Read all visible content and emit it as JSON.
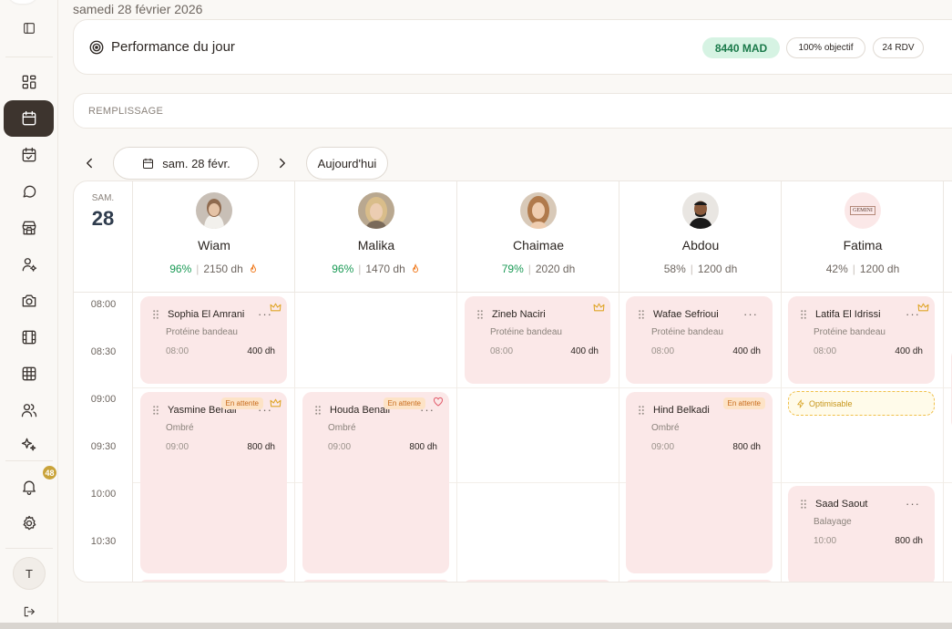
{
  "app": {
    "date_full": "samedi 28 février 2026"
  },
  "sidebar": {
    "notifications_count": "48",
    "user_initial": "T",
    "items": [
      {
        "name": "toggle-sidebar"
      },
      {
        "name": "dashboard"
      },
      {
        "name": "calendar",
        "active": true
      },
      {
        "name": "appointments"
      },
      {
        "name": "messages"
      },
      {
        "name": "store"
      },
      {
        "name": "staff-settings"
      },
      {
        "name": "camera"
      },
      {
        "name": "media"
      },
      {
        "name": "grid"
      },
      {
        "name": "clients"
      },
      {
        "name": "ai-sparkles"
      }
    ]
  },
  "performance": {
    "title": "Performance du jour",
    "revenue": "8440 MAD",
    "objective": "100% objectif",
    "appointments": "24 RDV"
  },
  "remplissage": {
    "label": "REMPLISSAGE"
  },
  "nav": {
    "date_label": "sam. 28 févr.",
    "today_label": "Aujourd'hui"
  },
  "calendar": {
    "day_of_week": "SAM.",
    "day_number": "28",
    "times": [
      "08:00",
      "08:30",
      "09:00",
      "09:30",
      "10:00",
      "10:30"
    ],
    "staff": [
      {
        "name": "Wiam",
        "pct": "96%",
        "revenue": "2150 dh",
        "hot": true,
        "green": true
      },
      {
        "name": "Malika",
        "pct": "96%",
        "revenue": "1470 dh",
        "hot": true,
        "green": true
      },
      {
        "name": "Chaimae",
        "pct": "79%",
        "revenue": "2020 dh",
        "hot": false,
        "green": true
      },
      {
        "name": "Abdou",
        "pct": "58%",
        "revenue": "1200 dh",
        "hot": false,
        "green": false
      },
      {
        "name": "Fatima",
        "pct": "42%",
        "revenue": "1200 dh",
        "hot": false,
        "green": false,
        "logo": "GEMINI"
      }
    ],
    "appointments": {
      "a1": {
        "client": "Sophia El Amrani",
        "service": "Protéine bandeau",
        "time": "08:00",
        "price": "400 dh"
      },
      "a2": {
        "client": "Zineb Naciri",
        "service": "Protéine bandeau",
        "time": "08:00",
        "price": "400 dh"
      },
      "a3": {
        "client": "Wafae Sefrioui",
        "service": "Protéine bandeau",
        "time": "08:00",
        "price": "400 dh"
      },
      "a4": {
        "client": "Latifa El Idrissi",
        "service": "Protéine bandeau",
        "time": "08:00",
        "price": "400 dh"
      },
      "a5": {
        "client": "Yasmine Benali",
        "service": "Ombré",
        "time": "09:00",
        "price": "800 dh",
        "status": "En attente"
      },
      "a6": {
        "client": "Houda Benali",
        "service": "Ombré",
        "time": "09:00",
        "price": "800 dh",
        "status": "En attente"
      },
      "a7": {
        "client": "Hind Belkadi",
        "service": "Ombré",
        "time": "09:00",
        "price": "800 dh",
        "status": "En attente"
      },
      "a8": {
        "client": "Saad Saout",
        "service": "Balayage",
        "time": "10:00",
        "price": "800 dh"
      }
    },
    "optimisable_label": "Optimisable"
  }
}
